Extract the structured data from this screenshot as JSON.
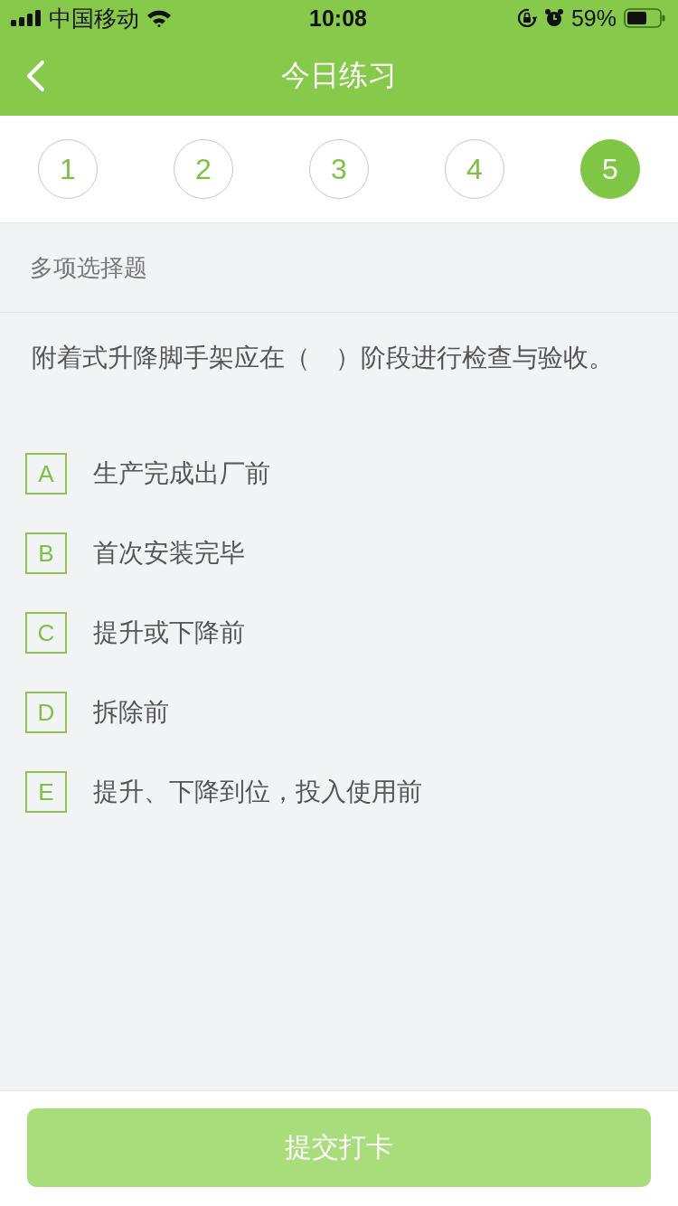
{
  "status_bar": {
    "carrier": "中国移动",
    "time": "10:08",
    "battery_percent": "59%"
  },
  "nav_bar": {
    "title": "今日练习"
  },
  "question_steps": [
    {
      "label": "1",
      "selected": false
    },
    {
      "label": "2",
      "selected": false
    },
    {
      "label": "3",
      "selected": false
    },
    {
      "label": "4",
      "selected": false
    },
    {
      "label": "5",
      "selected": true
    }
  ],
  "question_type": "多项选择题",
  "question": {
    "text": "附着式升降脚手架应在（　）阶段进行检查与验收。",
    "options": [
      {
        "letter": "A",
        "text": "生产完成出厂前",
        "selected": false
      },
      {
        "letter": "B",
        "text": "首次安装完毕",
        "selected": false
      },
      {
        "letter": "C",
        "text": "提升或下降前",
        "selected": false
      },
      {
        "letter": "D",
        "text": "拆除前",
        "selected": false
      },
      {
        "letter": "E",
        "text": "提升、下降到位，投入使用前",
        "selected": false
      }
    ]
  },
  "submit_button": {
    "label": "提交打卡",
    "disabled": true
  }
}
